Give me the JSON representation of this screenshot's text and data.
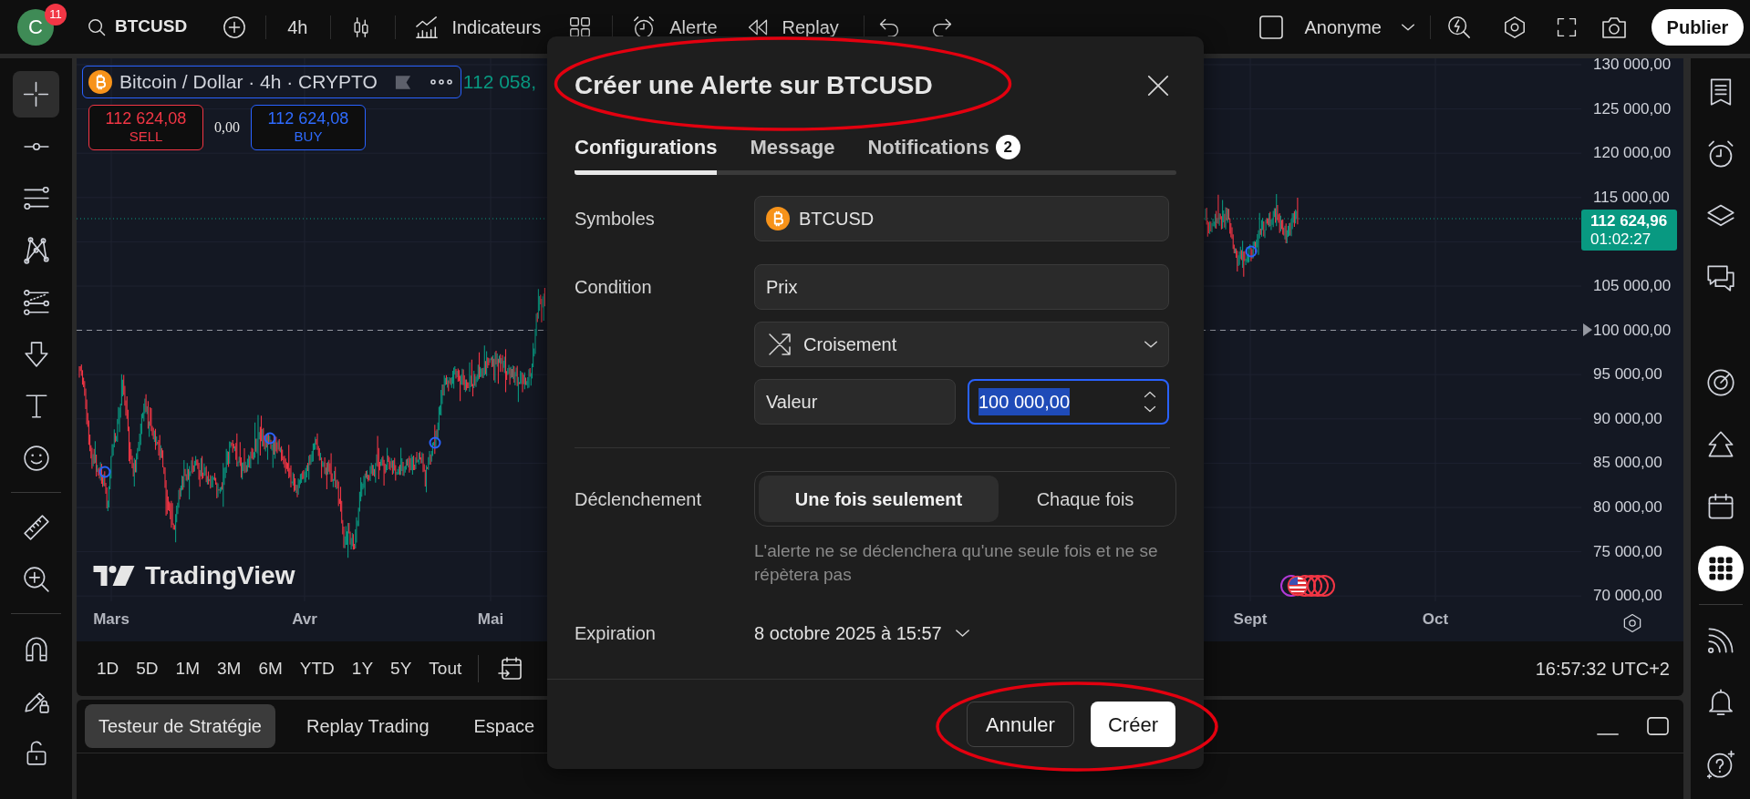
{
  "top_bar": {
    "avatar": {
      "letter": "C",
      "badge": "11"
    },
    "symbol": "BTCUSD",
    "interval": "4h",
    "indicators": "Indicateurs",
    "alert": "Alerte",
    "replay": "Replay",
    "layout": "Anonyme",
    "publish": "Publier"
  },
  "left_toolbar": {
    "groups": [
      [
        {
          "kind": "crosshair",
          "selected": true
        },
        {
          "kind": "trendline",
          "selected": false
        },
        {
          "kind": "fibonacci",
          "selected": false
        },
        {
          "kind": "patterns",
          "selected": false
        },
        {
          "kind": "forecast",
          "selected": false
        },
        {
          "kind": "arrows",
          "selected": false
        },
        {
          "kind": "text",
          "selected": false
        },
        {
          "kind": "emoji",
          "selected": false
        }
      ],
      [
        {
          "kind": "ruler",
          "selected": false
        },
        {
          "kind": "zoom",
          "selected": false
        }
      ],
      [
        {
          "kind": "magnet",
          "selected": false
        },
        {
          "kind": "drawlock",
          "selected": false
        },
        {
          "kind": "lock",
          "selected": false
        }
      ]
    ]
  },
  "chart": {
    "legend": {
      "title": "Bitcoin / Dollar · 4h · CRYPTO",
      "value": "112 058,"
    },
    "sell": {
      "price": "112 624,08",
      "label": "SELL"
    },
    "spread": "0,00",
    "buy": {
      "price": "112 624,08",
      "label": "BUY"
    },
    "logo": "TradingView",
    "price_labels": [
      "130 000,00",
      "125 000,00",
      "120 000,00",
      "115 000,00",
      "105 000,00",
      "100 000,00",
      "95 000,00",
      "90 000,00",
      "85 000,00",
      "80 000,00",
      "75 000,00",
      "70 000,00"
    ],
    "last_price": {
      "price": "112 624,96",
      "countdown": "01:02:27"
    },
    "time_labels": [
      "Mars",
      "Avr",
      "Mai",
      "Sept",
      "Oct"
    ]
  },
  "range_bar": {
    "ranges": [
      "1D",
      "5D",
      "1M",
      "3M",
      "6M",
      "YTD",
      "1Y",
      "5Y",
      "Tout"
    ],
    "clock": "16:57:32 UTC+2"
  },
  "bottom_panel": {
    "tabs": [
      {
        "label": "Testeur de Stratégie",
        "selected": true
      },
      {
        "label": "Replay Trading",
        "selected": false
      },
      {
        "label": "Espace",
        "selected": false
      }
    ]
  },
  "right_toolbar": {
    "groups": [
      [
        {
          "kind": "watchlist",
          "selected": false
        },
        {
          "kind": "alerts",
          "selected": false
        },
        {
          "kind": "layers",
          "selected": false
        },
        {
          "kind": "chat",
          "selected": false
        }
      ],
      [
        {
          "kind": "target",
          "selected": false
        },
        {
          "kind": "ideas",
          "selected": false
        },
        {
          "kind": "calendar",
          "selected": false
        },
        {
          "kind": "products",
          "selected": true
        }
      ],
      [
        {
          "kind": "streams",
          "selected": false
        },
        {
          "kind": "notifications",
          "selected": false
        },
        {
          "kind": "help",
          "selected": false
        }
      ]
    ]
  },
  "alert_dialog": {
    "title": "Créer une Alerte sur BTCUSD",
    "tabs": [
      {
        "label": "Configurations",
        "selected": true
      },
      {
        "label": "Message",
        "selected": false
      },
      {
        "label": "Notifications",
        "selected": false,
        "badge": "2"
      }
    ],
    "symbol": {
      "label": "Symboles",
      "value": "BTCUSD"
    },
    "condition": {
      "label": "Condition",
      "source": "Prix",
      "operator": "Croisement",
      "value_type": "Valeur",
      "value": {
        "text": "100 000,00",
        "focused": true
      }
    },
    "trigger": {
      "label": "Déclenchement",
      "options": [
        {
          "label": "Une fois seulement",
          "selected": true
        },
        {
          "label": "Chaque fois",
          "selected": false
        }
      ],
      "hint": "L'alerte ne se déclenchera qu'une seule fois et ne se répètera pas"
    },
    "expiration": {
      "label": "Expiration",
      "value": "8 octobre 2025 à 15:57"
    },
    "buttons": {
      "cancel": "Annuler",
      "create": "Créer"
    }
  }
}
